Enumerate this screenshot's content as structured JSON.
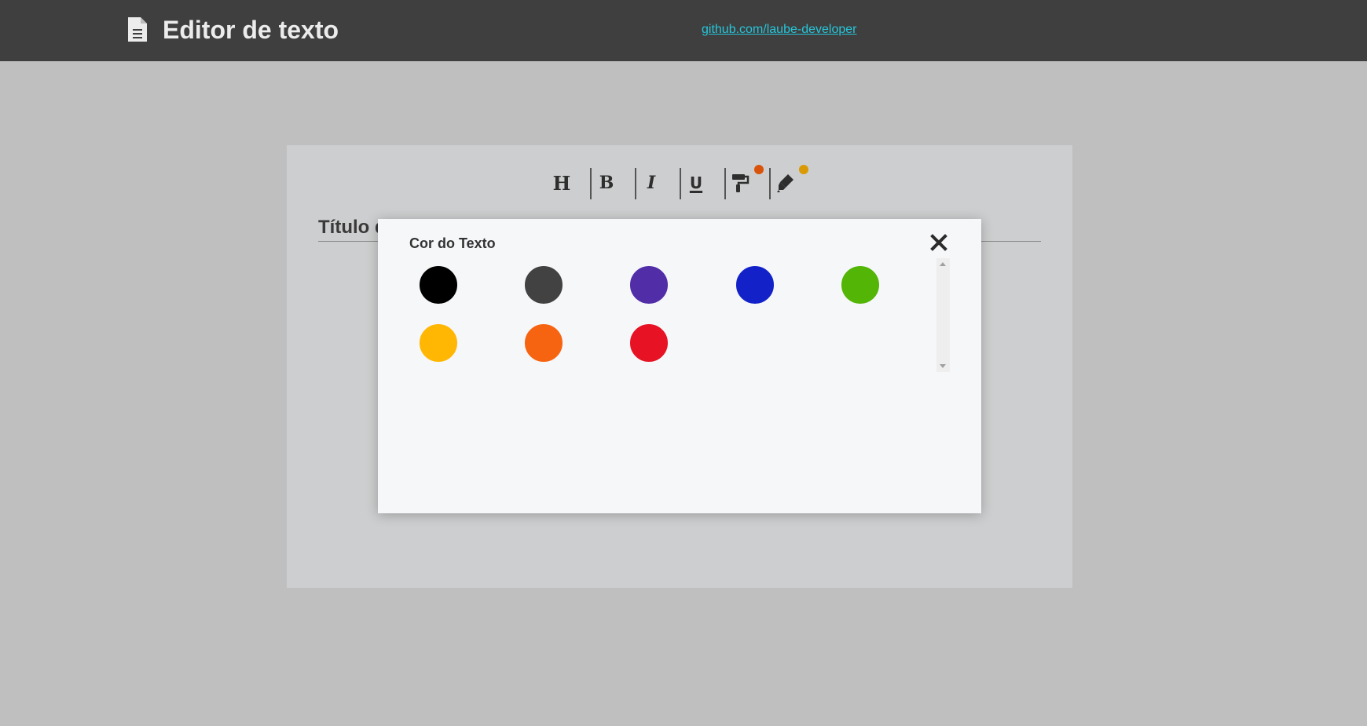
{
  "header": {
    "title": "Editor de texto",
    "link_text": "github.com/laube-developer",
    "logo_icon": "document-icon"
  },
  "toolbar": {
    "heading_label": "H",
    "bold_label": "B",
    "italic_label": "I",
    "underline_label": "U",
    "text_color_icon": "paint-roller-icon",
    "highlight_icon": "highlighter-pen-icon",
    "text_color_indicator": "#d9540a",
    "highlight_indicator": "#d99a06"
  },
  "editor": {
    "title_visible_text": "Título d"
  },
  "modal": {
    "title": "Cor do Texto",
    "close_icon": "close-icon",
    "colors": [
      "#000000",
      "#424242",
      "#512da8",
      "#1222c8",
      "#53b506",
      "#ffb703",
      "#f76411",
      "#e71224"
    ]
  }
}
